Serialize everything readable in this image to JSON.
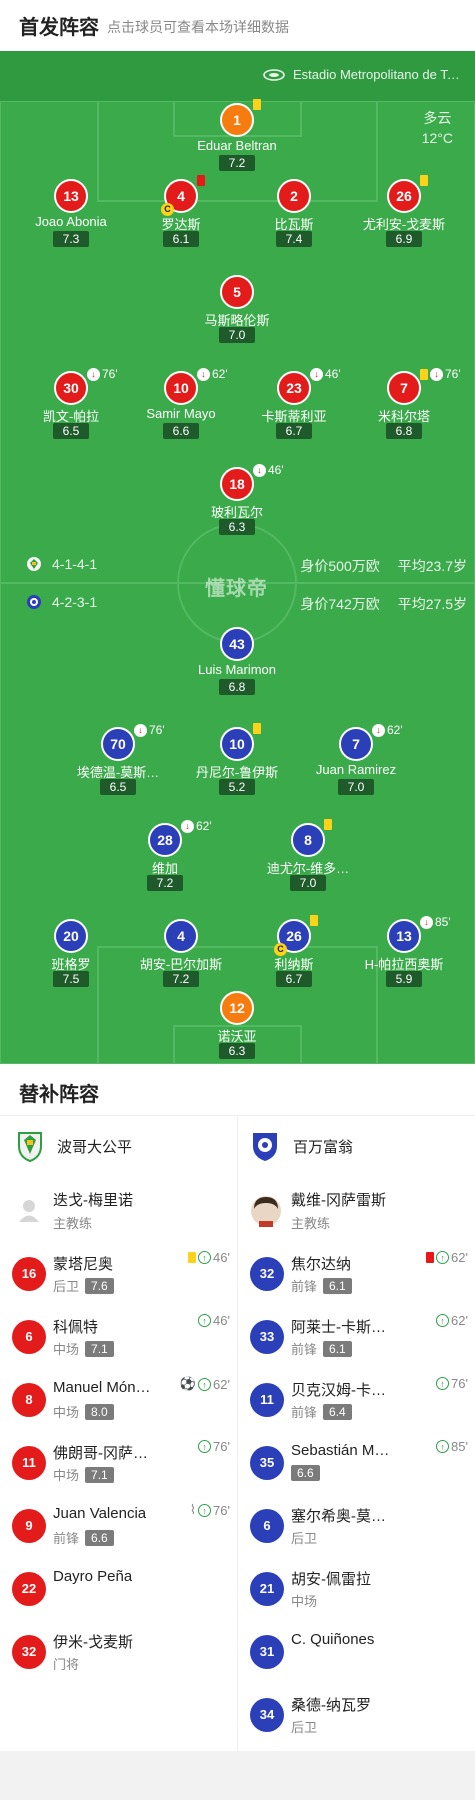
{
  "header": {
    "title": "首发阵容",
    "subtitle": "点击球员可查看本场详细数据"
  },
  "venue": {
    "stadium": "Estadio Metropolitano de Techo",
    "weather": "多云",
    "temperature": "12°C"
  },
  "watermark": "懂球帝",
  "home": {
    "formation": "4-1-4-1",
    "value": "身价500万欧",
    "avg_age": "平均23.7岁",
    "players": [
      {
        "num": "1",
        "name": "Eduar Beltran",
        "rating": "7.2",
        "events": [
          {
            "type": "yellow"
          }
        ]
      },
      {
        "num": "13",
        "name": "Joao Abonia",
        "rating": "7.3",
        "events": []
      },
      {
        "num": "4",
        "name": "罗达斯",
        "rating": "6.1",
        "captain": true,
        "events": [
          {
            "type": "red"
          }
        ]
      },
      {
        "num": "2",
        "name": "比瓦斯",
        "rating": "7.4",
        "events": []
      },
      {
        "num": "26",
        "name": "尤利安-戈麦斯",
        "rating": "6.9",
        "events": [
          {
            "type": "yellow"
          }
        ]
      },
      {
        "num": "5",
        "name": "马斯略伦斯",
        "rating": "7.0",
        "events": []
      },
      {
        "num": "30",
        "name": "凯文-帕拉",
        "rating": "6.5",
        "events": [
          {
            "type": "sub-out",
            "minute": "76'"
          }
        ]
      },
      {
        "num": "10",
        "name": "Samir Mayo",
        "rating": "6.6",
        "events": [
          {
            "type": "sub-out",
            "minute": "62'"
          }
        ]
      },
      {
        "num": "23",
        "name": "卡斯蒂利亚",
        "rating": "6.7",
        "events": [
          {
            "type": "sub-out",
            "minute": "46'"
          }
        ]
      },
      {
        "num": "7",
        "name": "米科尔塔",
        "rating": "6.8",
        "events": [
          {
            "type": "yellow"
          },
          {
            "type": "sub-out",
            "minute": "76'"
          }
        ]
      },
      {
        "num": "18",
        "name": "玻利瓦尔",
        "rating": "6.3",
        "events": [
          {
            "type": "sub-out",
            "minute": "46'"
          }
        ]
      }
    ]
  },
  "away": {
    "formation": "4-2-3-1",
    "value": "身价742万欧",
    "avg_age": "平均27.5岁",
    "players": [
      {
        "num": "43",
        "name": "Luis Marimon",
        "rating": "6.8",
        "events": []
      },
      {
        "num": "70",
        "name": "埃德温-莫斯…",
        "rating": "6.5",
        "events": [
          {
            "type": "sub-out",
            "minute": "76'"
          }
        ]
      },
      {
        "num": "10",
        "name": "丹尼尔-鲁伊斯",
        "rating": "5.2",
        "events": [
          {
            "type": "yellow"
          }
        ]
      },
      {
        "num": "7",
        "name": "Juan Ramirez",
        "rating": "7.0",
        "events": [
          {
            "type": "sub-out",
            "minute": "62'"
          }
        ]
      },
      {
        "num": "28",
        "name": "维加",
        "rating": "7.2",
        "events": [
          {
            "type": "sub-out",
            "minute": "62'"
          }
        ]
      },
      {
        "num": "8",
        "name": "迪尤尔-维多…",
        "rating": "7.0",
        "events": [
          {
            "type": "yellow"
          }
        ]
      },
      {
        "num": "20",
        "name": "班格罗",
        "rating": "7.5",
        "events": []
      },
      {
        "num": "4",
        "name": "胡安-巴尔加斯",
        "rating": "7.2",
        "events": []
      },
      {
        "num": "26",
        "name": "利纳斯",
        "rating": "6.7",
        "captain": true,
        "events": [
          {
            "type": "yellow"
          }
        ]
      },
      {
        "num": "13",
        "name": "H-帕拉西奥斯",
        "rating": "5.9",
        "events": [
          {
            "type": "sub-out",
            "minute": "85'"
          }
        ]
      },
      {
        "num": "12",
        "name": "诺沃亚",
        "rating": "6.3",
        "events": []
      }
    ]
  },
  "subs": {
    "title": "替补阵容",
    "home": {
      "team": "波哥大公平",
      "coach": {
        "name": "迭戈-梅里诺",
        "role": "主教练"
      },
      "players": [
        {
          "num": "16",
          "name": "蒙塔尼奥",
          "pos": "后卫",
          "rating": "7.6",
          "events": "46'",
          "yellow": true
        },
        {
          "num": "6",
          "name": "科佩特",
          "pos": "中场",
          "rating": "7.1",
          "events": "46'"
        },
        {
          "num": "8",
          "name": "Manuel Mónaco",
          "pos": "中场",
          "rating": "8.0",
          "events": "62'",
          "goal": true
        },
        {
          "num": "11",
          "name": "佛朗哥-冈萨…",
          "pos": "中场",
          "rating": "7.1",
          "events": "76'"
        },
        {
          "num": "9",
          "name": "Juan Valencia",
          "pos": "前锋",
          "rating": "6.6",
          "events": "76'",
          "assist": true
        },
        {
          "num": "22",
          "name": "Dayro Peña",
          "pos": "",
          "rating": ""
        },
        {
          "num": "32",
          "name": "伊米-戈麦斯",
          "pos": "门将",
          "rating": ""
        }
      ]
    },
    "away": {
      "team": "百万富翁",
      "coach": {
        "name": "戴维-冈萨雷斯",
        "role": "主教练"
      },
      "players": [
        {
          "num": "32",
          "name": "焦尔达纳",
          "pos": "前锋",
          "rating": "6.1",
          "events": "62'",
          "red": true
        },
        {
          "num": "33",
          "name": "阿莱士-卡斯…",
          "pos": "前锋",
          "rating": "6.1",
          "events": "62'"
        },
        {
          "num": "11",
          "name": "贝克汉姆-卡…",
          "pos": "前锋",
          "rating": "6.4",
          "events": "76'"
        },
        {
          "num": "35",
          "name": "Sebastián Mo…",
          "pos": "",
          "rating": "6.6",
          "events": "85'"
        },
        {
          "num": "6",
          "name": "塞尔希奥-莫…",
          "pos": "后卫",
          "rating": ""
        },
        {
          "num": "21",
          "name": "胡安-佩雷拉",
          "pos": "中场",
          "rating": ""
        },
        {
          "num": "31",
          "name": "C. Quiñones",
          "pos": "",
          "rating": ""
        },
        {
          "num": "34",
          "name": "桑德-纳瓦罗",
          "pos": "后卫",
          "rating": ""
        }
      ]
    }
  },
  "colors": {
    "pitch": "#3aaa4a",
    "home": "#e41b1b",
    "away": "#2a3fb8",
    "keeper": "#f77c10"
  }
}
